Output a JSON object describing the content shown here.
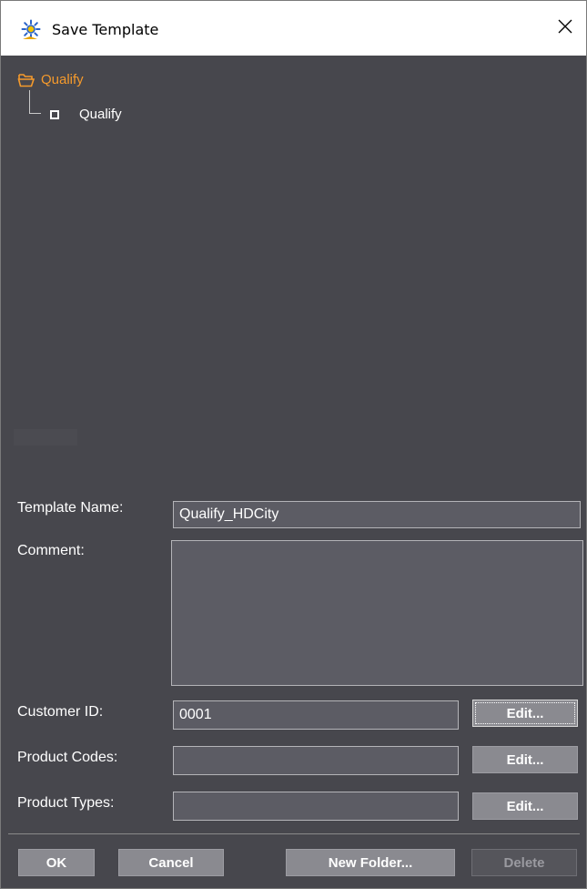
{
  "window": {
    "title": "Save Template",
    "icons": {
      "app": "gear-sparkle-icon",
      "close": "close-icon"
    }
  },
  "tree": {
    "root": {
      "label": "Qualify",
      "icon": "folder-open-icon",
      "color": "#f59a2c"
    },
    "children": [
      {
        "label": "Qualify",
        "icon": "checkbox-icon"
      }
    ]
  },
  "form": {
    "template_name": {
      "label": "Template Name:",
      "value": "Qualify_HDCity"
    },
    "comment": {
      "label": "Comment:",
      "value": ""
    },
    "customer_id": {
      "label": "Customer ID:",
      "value": "0001",
      "edit_label": "Edit..."
    },
    "product_codes": {
      "label": "Product Codes:",
      "value": "",
      "edit_label": "Edit..."
    },
    "product_types": {
      "label": "Product Types:",
      "value": "",
      "edit_label": "Edit..."
    }
  },
  "buttons": {
    "ok": "OK",
    "cancel": "Cancel",
    "new_folder": "New Folder...",
    "delete": "Delete"
  },
  "colors": {
    "background": "#47474d",
    "field": "#5c5c64",
    "button": "#8a8a90",
    "accent": "#f59a2c"
  }
}
